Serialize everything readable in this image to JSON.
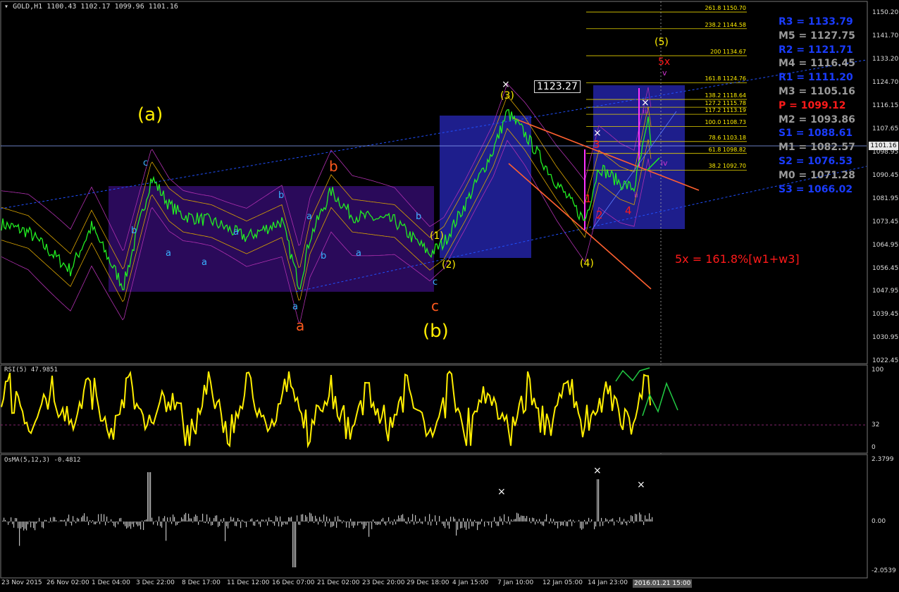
{
  "header": {
    "symbol_label": "GOLD,H1",
    "ohlc": "1100.43 1102.17 1099.96 1101.16"
  },
  "current_price": "1101.16",
  "price_axis": {
    "ticks": [
      "1150.20",
      "1141.70",
      "1133.20",
      "1124.70",
      "1116.15",
      "1107.65",
      "1098.95",
      "1090.45",
      "1081.95",
      "1073.45",
      "1064.95",
      "1056.45",
      "1047.95",
      "1039.45",
      "1030.95",
      "1022.45"
    ],
    "ylim": [
      1020,
      1153
    ]
  },
  "time_axis": {
    "labels": [
      "23 Nov 2015",
      "26 Nov 02:00",
      "1 Dec 04:00",
      "3 Dec 22:00",
      "8 Dec 17:00",
      "11 Dec 12:00",
      "16 Dec 07:00",
      "21 Dec 02:00",
      "23 Dec 20:00",
      "29 Dec 18:00",
      "4 Jan 15:00",
      "7 Jan 10:00",
      "12 Jan 05:00",
      "14 Jan 23:00"
    ],
    "cursor_label": "2016.01.21 15:00"
  },
  "marked_price": "1123.27",
  "fib_levels": [
    {
      "label": "261.8",
      "value": "1150.70"
    },
    {
      "label": "238.2",
      "value": "1144.58"
    },
    {
      "label": "200",
      "value": "1134.67"
    },
    {
      "label": "161.8",
      "value": "1124.76"
    },
    {
      "label": "138.2",
      "value": "1118.64"
    },
    {
      "label": "127.2",
      "value": "1115.78"
    },
    {
      "label": "117.2",
      "value": "1113.19"
    },
    {
      "label": "100.0",
      "value": "1108.73"
    },
    {
      "label": "78.6",
      "value": "1103.18"
    },
    {
      "label": "61.8",
      "value": "1098.82"
    },
    {
      "label": "38.2",
      "value": "1092.70"
    }
  ],
  "pivots": [
    {
      "name": "R3",
      "value": "1133.79",
      "color": "#1a3cff"
    },
    {
      "name": "M5",
      "value": "1127.75",
      "color": "#9a9a9a"
    },
    {
      "name": "R2",
      "value": "1121.71",
      "color": "#1a3cff"
    },
    {
      "name": "M4",
      "value": "1116.45",
      "color": "#9a9a9a"
    },
    {
      "name": "R1",
      "value": "1111.20",
      "color": "#1a3cff"
    },
    {
      "name": "M3",
      "value": "1105.16",
      "color": "#9a9a9a"
    },
    {
      "name": "P",
      "value": "1099.12",
      "color": "#ff1a1a"
    },
    {
      "name": "M2",
      "value": "1093.86",
      "color": "#9a9a9a"
    },
    {
      "name": "S1",
      "value": "1088.61",
      "color": "#1a3cff"
    },
    {
      "name": "M1",
      "value": "1082.57",
      "color": "#9a9a9a"
    },
    {
      "name": "S2",
      "value": "1076.53",
      "color": "#1a3cff"
    },
    {
      "name": "M0",
      "value": "1071.28",
      "color": "#9a9a9a"
    },
    {
      "name": "S3",
      "value": "1066.02",
      "color": "#1a3cff"
    }
  ],
  "wave_labels": [
    {
      "text": "(a)",
      "color": "#ffee00"
    },
    {
      "text": "b",
      "color": "#ff5a1e"
    },
    {
      "text": "a",
      "color": "#ff5a1e"
    },
    {
      "text": "c",
      "color": "#ff5a1e"
    },
    {
      "text": "(b)",
      "color": "#ffee00"
    },
    {
      "text": "(1)",
      "color": "#ffee00"
    },
    {
      "text": "(2)",
      "color": "#ffee00"
    },
    {
      "text": "(3)",
      "color": "#ffee00"
    },
    {
      "text": "(4)",
      "color": "#ffee00"
    },
    {
      "text": "(5)",
      "color": "#ffee00"
    },
    {
      "text": "5x",
      "color": "#ff1a1a"
    },
    {
      "text": "1",
      "color": "#ff1a1a"
    },
    {
      "text": "2",
      "color": "#ff1a1a"
    },
    {
      "text": "3",
      "color": "#ff1a1a"
    },
    {
      "text": "4",
      "color": "#ff1a1a"
    },
    {
      "text": "ii",
      "color": "#cc33cc"
    },
    {
      "text": "iii",
      "color": "#cc33cc"
    },
    {
      "text": "iv",
      "color": "#cc33cc"
    },
    {
      "text": "v",
      "color": "#cc33cc"
    },
    {
      "text": "c",
      "color": "#3ab0ff"
    },
    {
      "text": "a",
      "color": "#3ab0ff"
    },
    {
      "text": "b",
      "color": "#3ab0ff"
    }
  ],
  "annotation_5x": "5x = 161.8%[w1+w3]",
  "rsi": {
    "label": "RSI(5) 47.9851",
    "axis": [
      "100",
      "32",
      "0"
    ]
  },
  "osma": {
    "label": "OsMA(5,12,3) -0.4812",
    "axis": [
      "2.3799",
      "0.00",
      "-2.0539"
    ]
  },
  "colors": {
    "price_line": "#22ee22",
    "rsi_line": "#ffee00",
    "osma_bar": "#c0c0c0",
    "box_purple": "#2a0a5a",
    "box_blue": "#1e1e8c",
    "channel": "#2050ff",
    "orange": "#ff6030"
  }
}
